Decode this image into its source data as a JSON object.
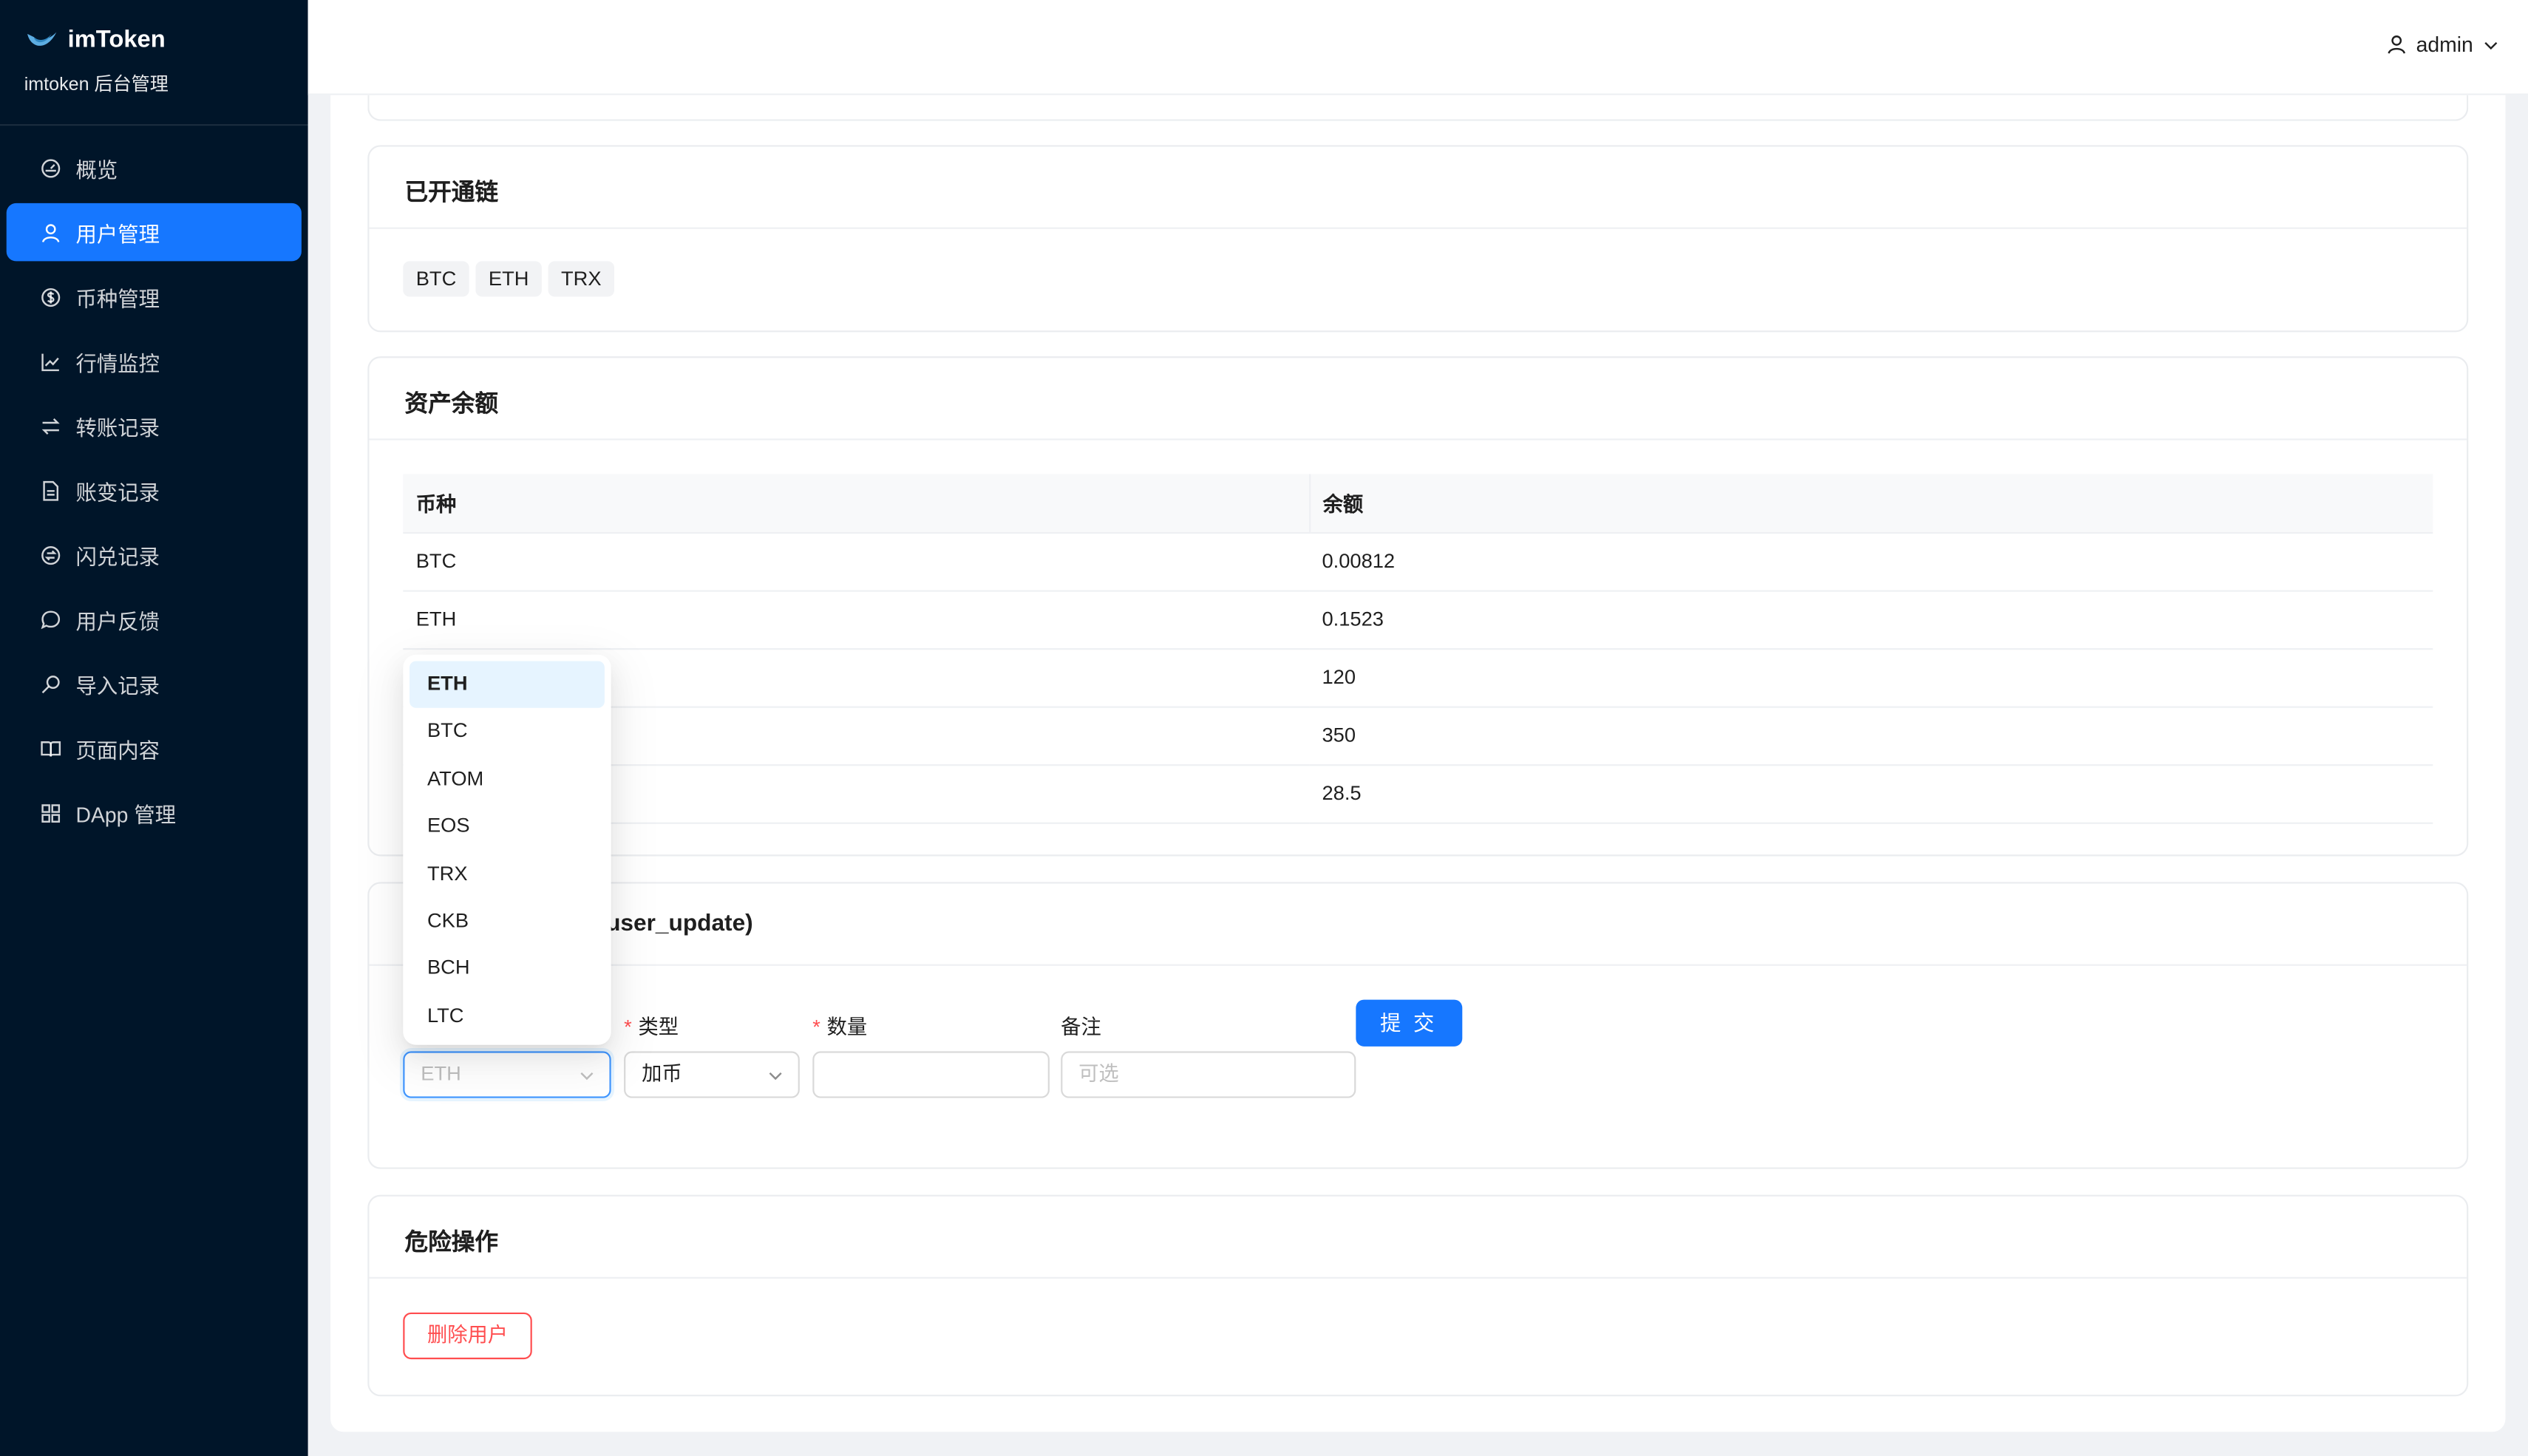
{
  "brand": {
    "name": "imToken",
    "subtitle": "imtoken 后台管理"
  },
  "sidebar": {
    "items": [
      {
        "label": "概览",
        "icon": "dashboard-icon"
      },
      {
        "label": "用户管理",
        "icon": "user-icon",
        "active": true
      },
      {
        "label": "币种管理",
        "icon": "dollar-icon"
      },
      {
        "label": "行情监控",
        "icon": "line-chart-icon"
      },
      {
        "label": "转账记录",
        "icon": "swap-icon"
      },
      {
        "label": "账变记录",
        "icon": "file-icon"
      },
      {
        "label": "闪兑记录",
        "icon": "exchange-icon"
      },
      {
        "label": "用户反馈",
        "icon": "message-icon"
      },
      {
        "label": "导入记录",
        "icon": "search-key-icon"
      },
      {
        "label": "页面内容",
        "icon": "read-icon"
      },
      {
        "label": "DApp 管理",
        "icon": "appstore-icon"
      }
    ],
    "accent": "#1677ff",
    "background": "#001529"
  },
  "header": {
    "user": "admin"
  },
  "chains": {
    "title": "已开通链",
    "tags": [
      "BTC",
      "ETH",
      "TRX"
    ]
  },
  "balances": {
    "title": "资产余额",
    "columns": [
      "币种",
      "余额"
    ],
    "rows": [
      {
        "coin": "BTC",
        "amount": "0.00812"
      },
      {
        "coin": "ETH",
        "amount": "0.1523"
      },
      {
        "coin": "",
        "amount": "120"
      },
      {
        "coin": "",
        "amount": "350"
      },
      {
        "coin": "",
        "amount": "28.5"
      }
    ]
  },
  "adjust": {
    "title_visible": "user_update)",
    "type_label": "类型",
    "qty_label": "数量",
    "note_label": "备注",
    "coin_placeholder": "ETH",
    "type_value": "加币",
    "note_placeholder": "可选",
    "submit_label": "提 交",
    "required_mark": "*"
  },
  "coin_dropdown": {
    "selected": "ETH",
    "options": [
      "ETH",
      "BTC",
      "ATOM",
      "EOS",
      "TRX",
      "CKB",
      "BCH",
      "LTC"
    ]
  },
  "danger": {
    "title": "危险操作",
    "delete_label": "删除用户",
    "danger_color": "#ff4d4f"
  }
}
